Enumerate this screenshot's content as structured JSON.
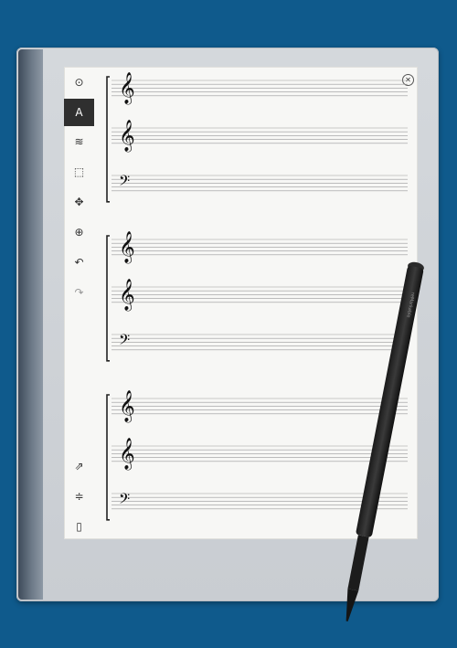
{
  "device": {
    "toolbar_icons": [
      "menu-circle-icon",
      "pen-icon",
      "strokes-icon",
      "eraser-icon",
      "move-icon",
      "zoom-icon",
      "undo-icon",
      "redo-icon",
      "share-icon",
      "layers-icon",
      "page-icon"
    ],
    "active_tool": "pen-icon",
    "pen_brand": "reMarkable"
  },
  "template": {
    "systems": 3,
    "staves_per_system": 3,
    "clefs": [
      "treble",
      "treble",
      "bass"
    ]
  },
  "glyphs": {
    "menu": "⊙",
    "pen": "A",
    "strokes": "≋",
    "eraser": "⬚",
    "move": "✥",
    "zoom": "⊕",
    "undo": "↶",
    "redo": "↷",
    "share": "⇗",
    "layers": "≑",
    "page": "▯",
    "close": "✕",
    "treble": "𝄞",
    "bass": "𝄢"
  },
  "colors": {
    "background": "#0f5a8c",
    "screen": "#f7f7f5",
    "lines": "#9a9a9a"
  }
}
